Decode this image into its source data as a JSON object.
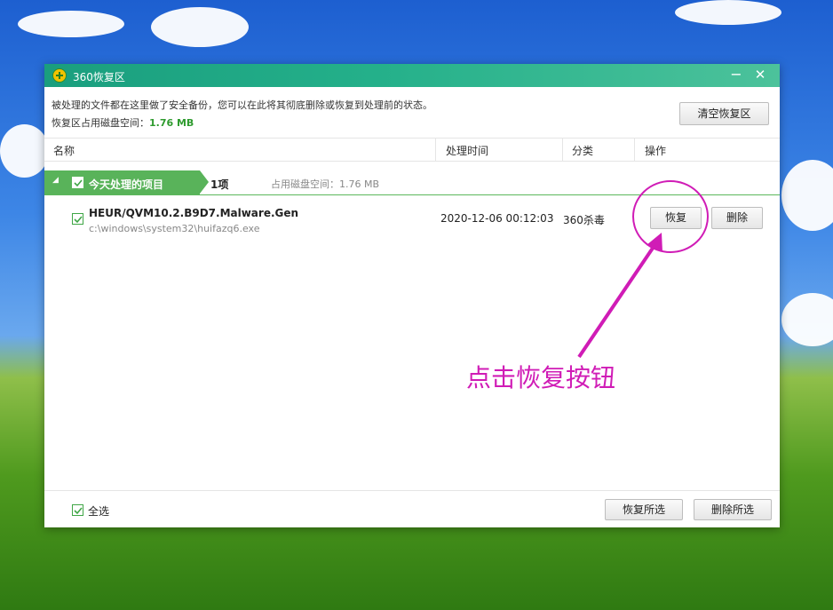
{
  "window": {
    "title": "360恢复区",
    "minimize_symbol": "−",
    "close_symbol": "✕"
  },
  "info": {
    "line1": "被处理的文件都在这里做了安全备份，您可以在此将其彻底删除或恢复到处理前的状态。",
    "line2_label": "恢复区占用磁盘空间：",
    "line2_value": "1.76 MB"
  },
  "toolbar": {
    "clear_label": "清空恢复区"
  },
  "columns": {
    "name": "名称",
    "time": "处理时间",
    "category": "分类",
    "action": "操作"
  },
  "group": {
    "expand_symbol": "◢",
    "label": "今天处理的项目",
    "count": "1项",
    "space": "占用磁盘空间：1.76 MB"
  },
  "items": [
    {
      "name": "HEUR/QVM10.2.B9D7.Malware.Gen",
      "path": "c:\\windows\\system32\\huifazq6.exe",
      "time": "2020-12-06 00:12:03",
      "category": "360杀毒",
      "restore_label": "恢复",
      "delete_label": "删除"
    }
  ],
  "footer": {
    "select_all_label": "全选",
    "restore_selected_label": "恢复所选",
    "delete_selected_label": "删除所选"
  },
  "annotation": {
    "text": "点击恢复按钮",
    "color": "#d01cb6"
  },
  "colors": {
    "accent_green": "#59b35a",
    "titlebar": "#1a9e7e"
  }
}
